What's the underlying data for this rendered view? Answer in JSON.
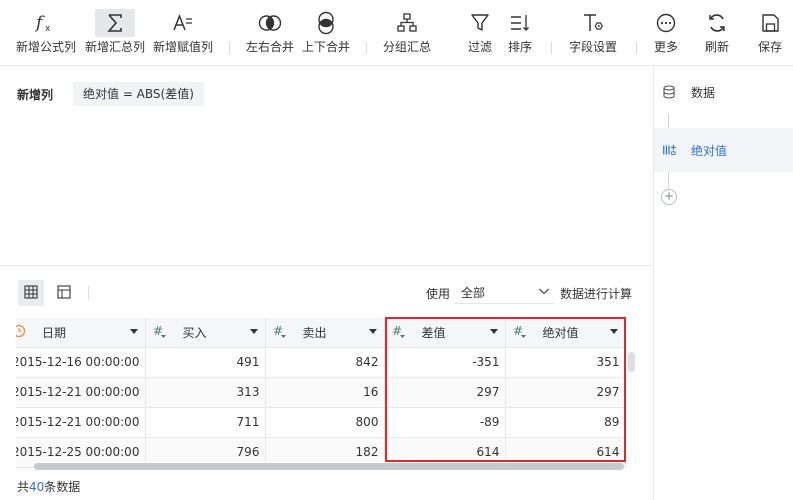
{
  "toolbar": {
    "items": [
      {
        "label": "新增公式列",
        "icon": "function-icon"
      },
      {
        "label": "新增汇总列",
        "icon": "sigma-icon"
      },
      {
        "label": "新增赋值列",
        "icon": "assign-icon"
      },
      {
        "label": "左右合并",
        "icon": "merge-horizontal-icon"
      },
      {
        "label": "上下合并",
        "icon": "merge-vertical-icon"
      },
      {
        "label": "分组汇总",
        "icon": "group-tree-icon"
      },
      {
        "label": "过滤",
        "icon": "filter-icon"
      },
      {
        "label": "排序",
        "icon": "sort-icon"
      },
      {
        "label": "字段设置",
        "icon": "field-settings-icon"
      },
      {
        "label": "更多",
        "icon": "more-icon"
      },
      {
        "label": "刷新",
        "icon": "refresh-icon"
      },
      {
        "label": "保存",
        "icon": "save-icon"
      }
    ]
  },
  "formula": {
    "label": "新增列",
    "expression": "绝对值 = ABS(差值)"
  },
  "steps": [
    {
      "label": "数据",
      "icon": "database-icon"
    },
    {
      "label": "绝对值",
      "icon": "new-column-icon"
    }
  ],
  "add_step_symbol": "+",
  "use_bar": {
    "prefix": "使用",
    "selected": "全部",
    "suffix": "数据进行计算"
  },
  "table": {
    "columns": [
      {
        "name": "日期",
        "type_icon": "date-type-icon"
      },
      {
        "name": "买入",
        "type_icon": "number-type-icon"
      },
      {
        "name": "卖出",
        "type_icon": "number-type-icon"
      },
      {
        "name": "差值",
        "type_icon": "number-type-icon"
      },
      {
        "name": "绝对值",
        "type_icon": "number-type-icon"
      }
    ],
    "rows": [
      [
        "2015-12-16 00:00:00",
        "491",
        "842",
        "-351",
        "351"
      ],
      [
        "2015-12-21 00:00:00",
        "313",
        "16",
        "297",
        "297"
      ],
      [
        "2015-12-21 00:00:00",
        "711",
        "800",
        "-89",
        "89"
      ],
      [
        "2015-12-25 00:00:00",
        "796",
        "182",
        "614",
        "614"
      ]
    ]
  },
  "footer": {
    "prefix": "共",
    "count": "40",
    "suffix": "条数据"
  },
  "colors": {
    "accent": "#2f6fd6",
    "highlight": "#e0282e",
    "type_icon": "#4a7a6a"
  }
}
